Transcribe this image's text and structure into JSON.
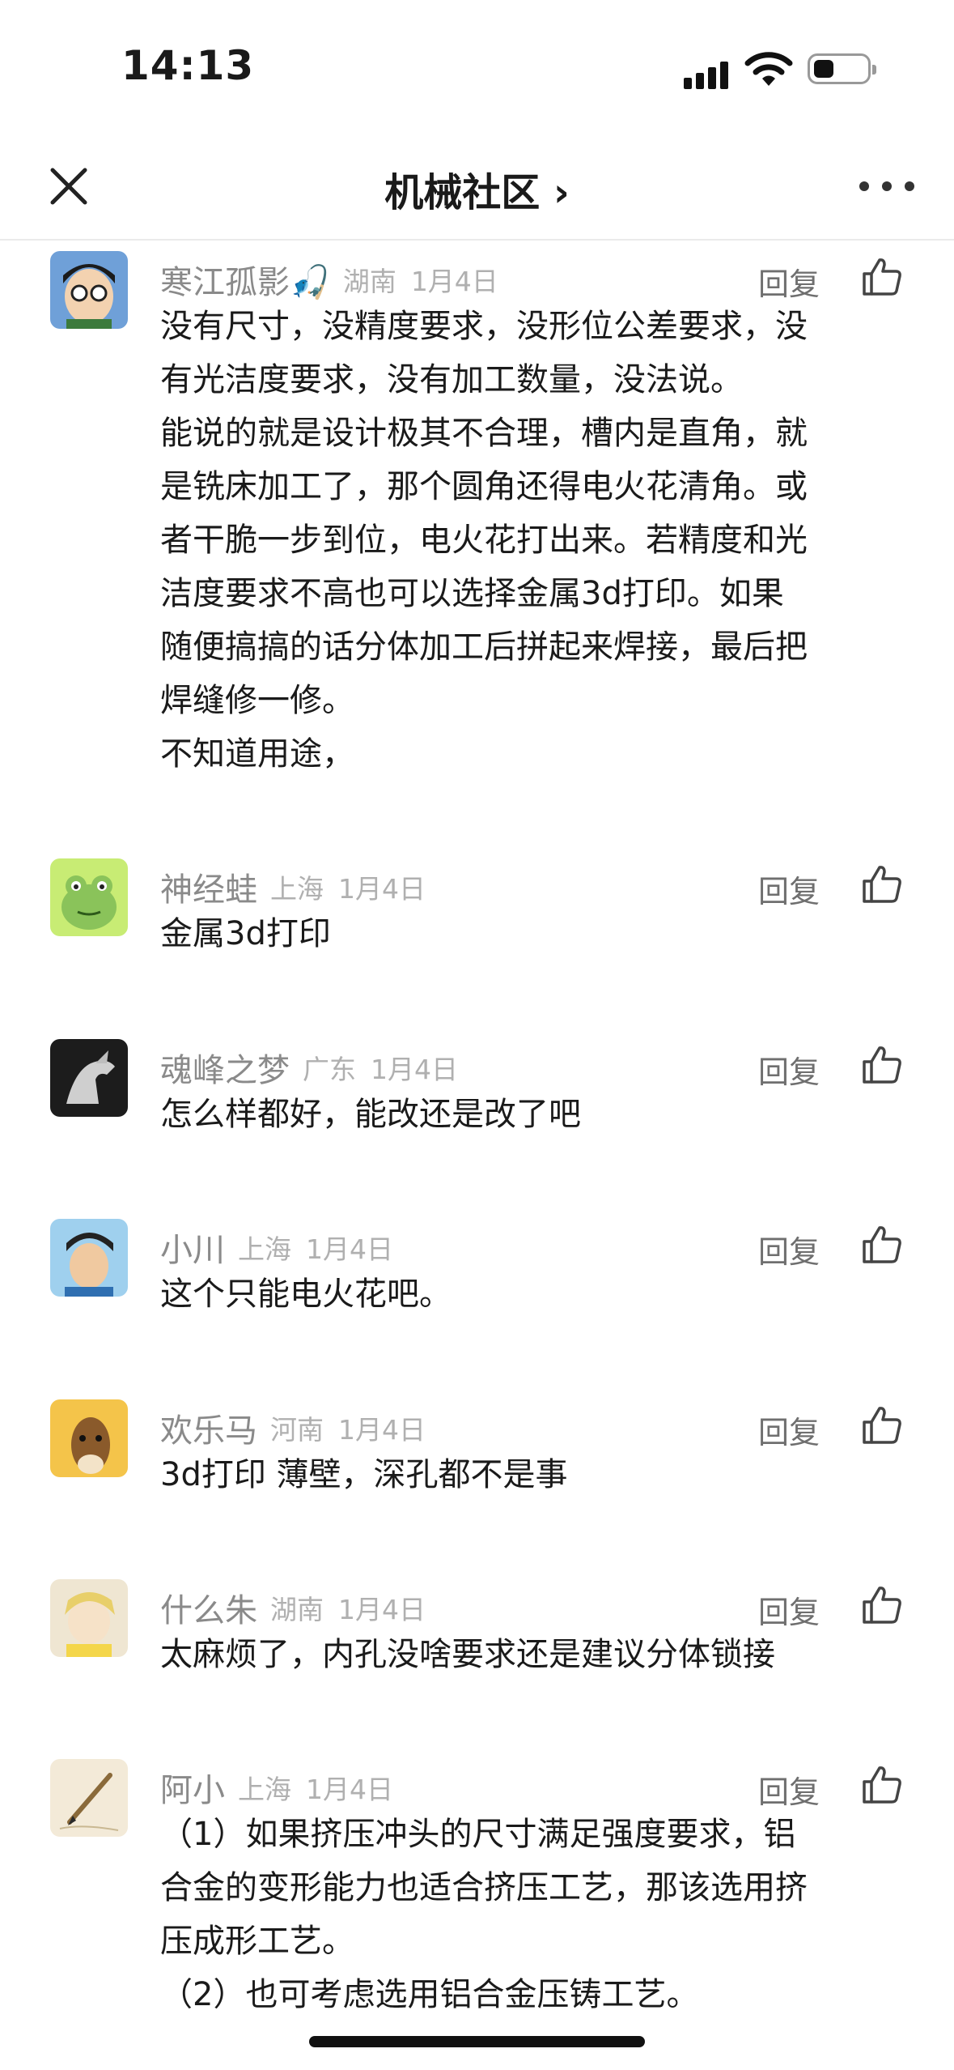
{
  "status_bar": {
    "time": "14:13"
  },
  "nav": {
    "title": "机械社区 ›"
  },
  "comments": [
    {
      "username": "寒江孤影🎣",
      "region": "湖南",
      "date": "1月4日",
      "reply_label": "回复",
      "lines": [
        "没有尺寸，没精度要求，没形位公差要求，没",
        "有光洁度要求，没有加工数量，没法说。",
        "能说的就是设计极其不合理，槽内是直角，就",
        "是铣床加工了，那个圆角还得电火花清角。或",
        "者干脆一步到位，电火花打出来。若精度和光",
        "洁度要求不高也可以选择金属3d打印。如果",
        "随便搞搞的话分体加工后拼起来焊接，最后把",
        "焊缝修一修。",
        "不知道用途，"
      ]
    },
    {
      "username": "神经蛙",
      "region": "上海",
      "date": "1月4日",
      "reply_label": "回复",
      "lines": [
        "金属3d打印"
      ]
    },
    {
      "username": "魂峰之梦",
      "region": "广东",
      "date": "1月4日",
      "reply_label": "回复",
      "lines": [
        "怎么样都好，能改还是改了吧"
      ]
    },
    {
      "username": "小川",
      "region": "上海",
      "date": "1月4日",
      "reply_label": "回复",
      "lines": [
        "这个只能电火花吧。"
      ]
    },
    {
      "username": "欢乐马",
      "region": "河南",
      "date": "1月4日",
      "reply_label": "回复",
      "lines": [
        "3d打印 薄壁，深孔都不是事"
      ]
    },
    {
      "username": "什么朱",
      "region": "湖南",
      "date": "1月4日",
      "reply_label": "回复",
      "lines": [
        "太麻烦了，内孔没啥要求还是建议分体锁接"
      ]
    },
    {
      "username": "阿小",
      "region": "上海",
      "date": "1月4日",
      "reply_label": "回复",
      "lines": [
        "（1）如果挤压冲头的尺寸满足强度要求，铝",
        "合金的变形能力也适合挤压工艺，那该选用挤",
        "压成形工艺。",
        "（2）也可考虑选用铝合金压铸工艺。"
      ]
    }
  ],
  "icons": {
    "close": "close-icon",
    "more": "more-icon",
    "like": "thumbs-up-icon",
    "chevron": "chevron-right-icon"
  },
  "colors": {
    "meta_gray": "#8a8a8a",
    "light_gray": "#b0b0b0",
    "text": "#1a1a1a"
  }
}
